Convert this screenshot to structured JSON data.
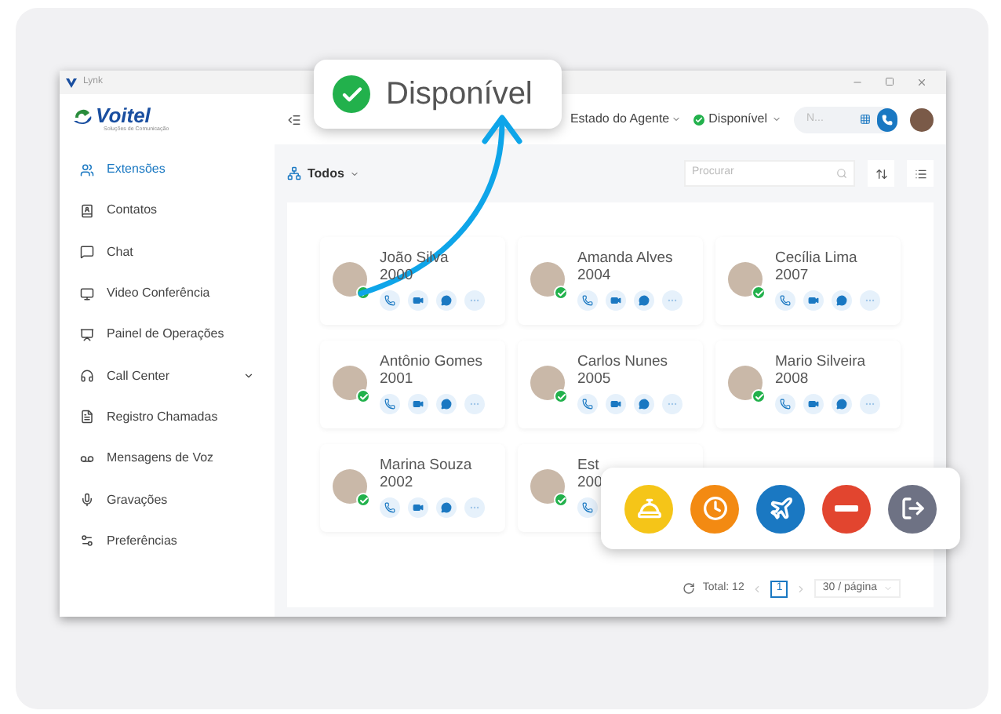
{
  "window": {
    "title": "Lynk"
  },
  "logo": {
    "name": "Voitel",
    "tagline": "Soluções de Comunicação"
  },
  "sidebar": {
    "items": [
      {
        "label": "Extensões",
        "selected": true,
        "expandable": false
      },
      {
        "label": "Contatos",
        "selected": false,
        "expandable": false
      },
      {
        "label": "Chat",
        "selected": false,
        "expandable": false
      },
      {
        "label": "Video Conferência",
        "selected": false,
        "expandable": false
      },
      {
        "label": "Painel de Operações",
        "selected": false,
        "expandable": false
      },
      {
        "label": "Call Center",
        "selected": false,
        "expandable": true
      },
      {
        "label": "Registro Chamadas",
        "selected": false,
        "expandable": false
      },
      {
        "label": "Mensagens de Voz",
        "selected": false,
        "expandable": false
      },
      {
        "label": "Gravações",
        "selected": false,
        "expandable": false
      },
      {
        "label": "Preferências",
        "selected": false,
        "expandable": false
      }
    ]
  },
  "header": {
    "agent_state": "Estado do Agente",
    "status": "Disponível",
    "dial_placeholder": "N..."
  },
  "toolbar": {
    "filter": "Todos",
    "search_placeholder": "Procurar"
  },
  "extensions": [
    {
      "name": "João Silva",
      "number": "2000",
      "available": true
    },
    {
      "name": "Amanda Alves",
      "number": "2004",
      "available": true
    },
    {
      "name": "Cecília Lima",
      "number": "2007",
      "available": true
    },
    {
      "name": "Antônio Gomes",
      "number": "2001",
      "available": true
    },
    {
      "name": "Carlos Nunes",
      "number": "2005",
      "available": true
    },
    {
      "name": "Mario Silveira",
      "number": "2008",
      "available": true
    },
    {
      "name": "Marina Souza",
      "number": "2002",
      "available": true
    },
    {
      "name": "Est",
      "number": "200",
      "available": true
    }
  ],
  "pagination": {
    "total": "Total: 12",
    "page": "1",
    "page_size": "30 / página"
  },
  "callout": {
    "status": "Disponível"
  },
  "status_options": [
    {
      "kind": "service",
      "color": "#f5c518"
    },
    {
      "kind": "clock",
      "color": "#f38a12"
    },
    {
      "kind": "plane",
      "color": "#1a78c2"
    },
    {
      "kind": "busy",
      "color": "#e2452f"
    },
    {
      "kind": "logout",
      "color": "#6e7284"
    }
  ]
}
